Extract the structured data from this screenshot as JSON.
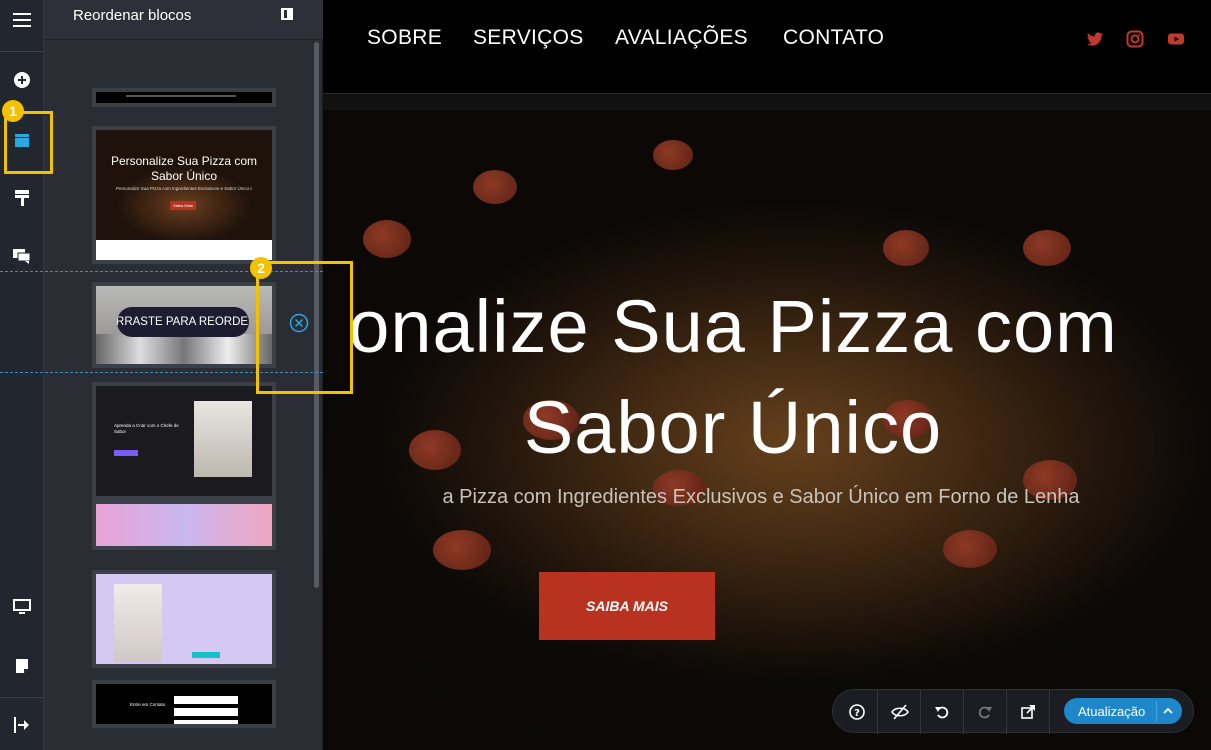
{
  "panel": {
    "title": "Reordenar blocos",
    "drag_hint": "ARRASTE PARA REORDE..."
  },
  "thumbs": {
    "hero_title": "Personalize Sua Pizza com Sabor Único",
    "hero_sub": "Personalize Sua Pizza com Ingredientes Exclusivos e Sabor Único em Forno de Lenha",
    "hero_btn": "Saiba Mais",
    "block3_title": "Aprenda a Criar com o Chefe de Sabor",
    "block5_title": "Entre em Contato"
  },
  "site": {
    "nav": [
      "SOBRE",
      "SERVIÇOS",
      "AVALIAÇÕES",
      "CONTATO"
    ],
    "hero_title_line1": "onalize Sua Pizza com",
    "hero_title_line2": "Sabor Único",
    "hero_subtitle": "a Pizza com Ingredientes Exclusivos e Sabor Único em Forno de Lenha",
    "cta": "SAIBA MAIS"
  },
  "annotations": [
    "1",
    "2"
  ],
  "bottom_bar": {
    "update": "Atualização"
  },
  "colors": {
    "accent": "#1e87c9",
    "annotation": "#f2c200",
    "cta": "#b8321f",
    "social": "#c0392b"
  },
  "icons": [
    "menu-icon",
    "add-icon",
    "blocks-icon",
    "paint-icon",
    "comments-icon",
    "desktop-icon",
    "pages-icon",
    "exit-icon",
    "panel-toggle-icon",
    "remove-icon",
    "help-icon",
    "hide-icon",
    "undo-icon",
    "redo-icon",
    "external-link-icon",
    "chevron-up-icon",
    "twitter-icon",
    "instagram-icon",
    "youtube-icon"
  ]
}
